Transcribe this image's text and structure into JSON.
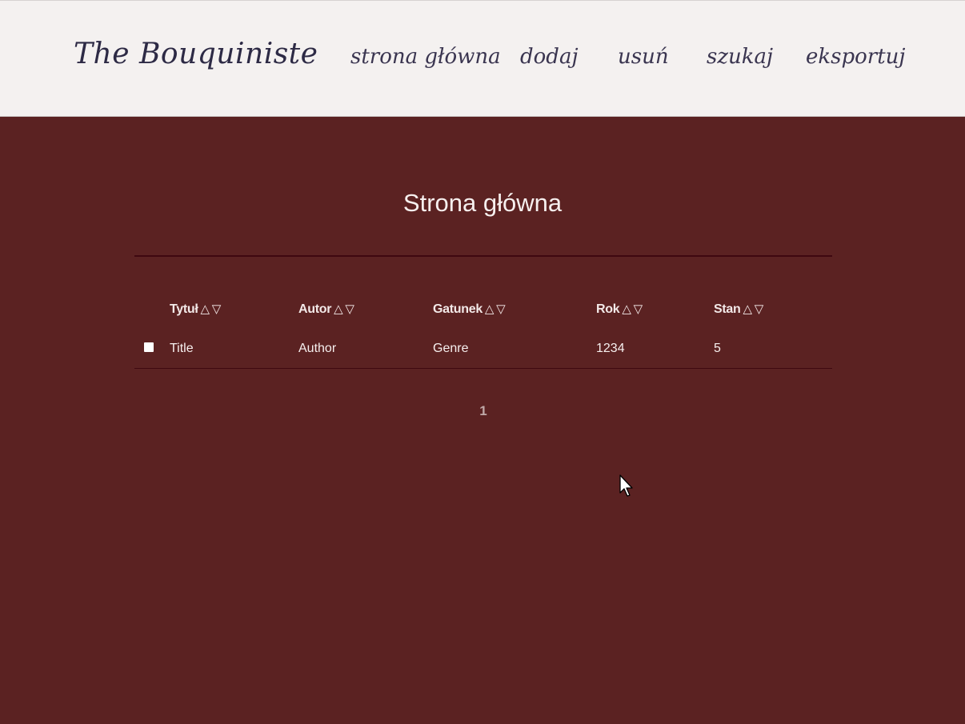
{
  "header": {
    "logo": "The Bouquiniste",
    "nav": [
      {
        "label": "strona główna"
      },
      {
        "label": "dodaj"
      },
      {
        "label": "usuń"
      },
      {
        "label": "szukaj"
      },
      {
        "label": "eksportuj"
      }
    ]
  },
  "main": {
    "title": "Strona główna",
    "sort_up_glyph": "△",
    "sort_down_glyph": "▽",
    "columns": [
      {
        "label": "Tytuł"
      },
      {
        "label": "Autor"
      },
      {
        "label": "Gatunek"
      },
      {
        "label": "Rok"
      },
      {
        "label": "Stan"
      }
    ],
    "rows": [
      {
        "title": "Title",
        "author": "Author",
        "genre": "Genre",
        "year": "1234",
        "state": "5"
      }
    ],
    "pagination": {
      "current": "1"
    }
  },
  "colors": {
    "background": "#5b2222",
    "header_bg": "#f4f1f0",
    "logo_text": "#2d2a45",
    "rule": "#3f0810",
    "text": "#f6efee"
  },
  "icons": {
    "cursor": "mouse-pointer-icon"
  }
}
